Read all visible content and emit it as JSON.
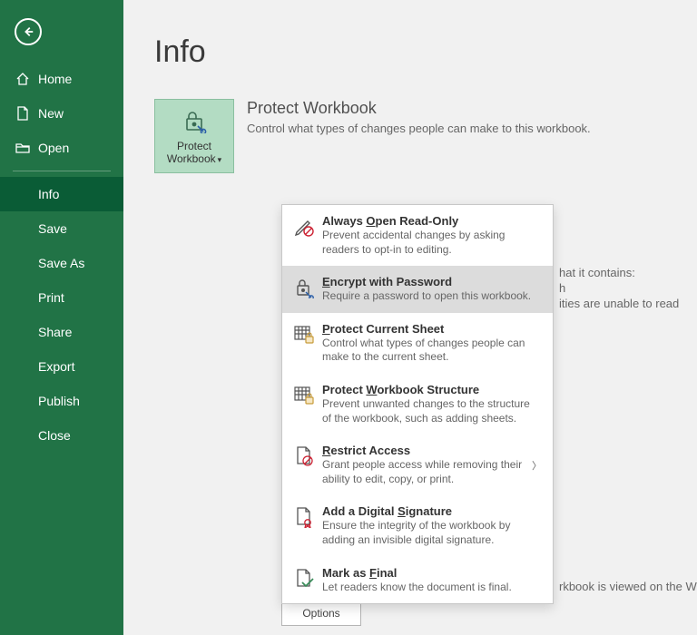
{
  "sidebar": {
    "items": [
      {
        "label": "Home"
      },
      {
        "label": "New"
      },
      {
        "label": "Open"
      },
      {
        "label": "Info"
      },
      {
        "label": "Save"
      },
      {
        "label": "Save As"
      },
      {
        "label": "Print"
      },
      {
        "label": "Share"
      },
      {
        "label": "Export"
      },
      {
        "label": "Publish"
      },
      {
        "label": "Close"
      }
    ]
  },
  "page": {
    "title": "Info"
  },
  "protect": {
    "button_line1": "Protect",
    "button_line2": "Workbook",
    "heading": "Protect Workbook",
    "desc": "Control what types of changes people can make to this workbook."
  },
  "menu": {
    "items": [
      {
        "title_pre": "Always ",
        "title_u": "O",
        "title_post": "pen Read-Only",
        "desc": "Prevent accidental changes by asking readers to opt-in to editing."
      },
      {
        "title_pre": "",
        "title_u": "E",
        "title_post": "ncrypt with Password",
        "desc": "Require a password to open this workbook."
      },
      {
        "title_pre": "",
        "title_u": "P",
        "title_post": "rotect Current Sheet",
        "desc": "Control what types of changes people can make to the current sheet."
      },
      {
        "title_pre": "Protect ",
        "title_u": "W",
        "title_post": "orkbook Structure",
        "desc": "Prevent unwanted changes to the structure of the workbook, such as adding sheets."
      },
      {
        "title_pre": "",
        "title_u": "R",
        "title_post": "estrict Access",
        "desc": "Grant people access while removing their ability to edit, copy, or print.",
        "submenu": true
      },
      {
        "title_pre": "Add a Digital ",
        "title_u": "S",
        "title_post": "ignature",
        "desc": "Ensure the integrity of the workbook by adding an invisible digital signature."
      },
      {
        "title_pre": "Mark as ",
        "title_u": "F",
        "title_post": "inal",
        "desc": "Let readers know the document is final."
      }
    ]
  },
  "behind": {
    "l1": "hat it contains:",
    "l2": "h",
    "l3": "ities are unable to read",
    "bottom": "rkbook is viewed on the Web."
  },
  "browser_btn": "Browser View Options"
}
